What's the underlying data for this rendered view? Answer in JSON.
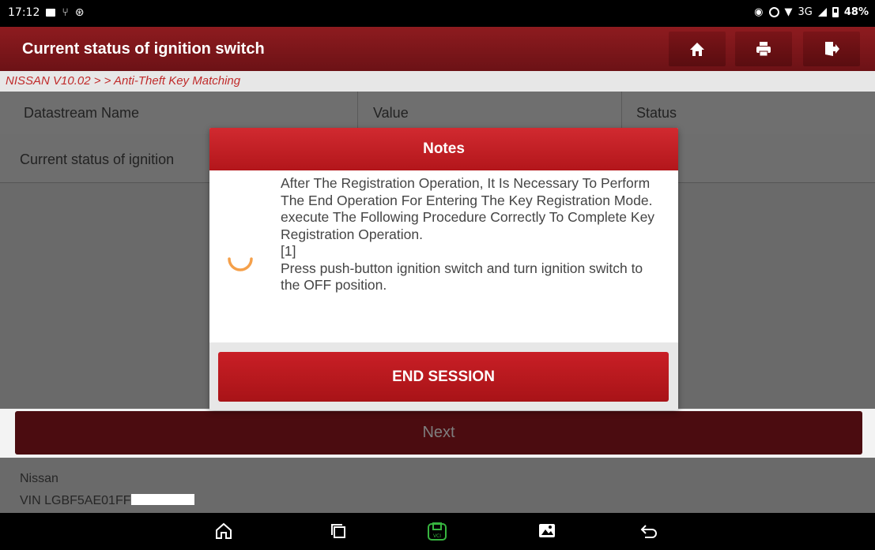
{
  "status_bar": {
    "time": "17:12",
    "network": "3G",
    "battery": "48%",
    "icons": [
      "image-icon",
      "usb-icon",
      "bluetooth-icon",
      "location-icon",
      "dnd-icon",
      "wifi-icon",
      "signal-icon",
      "battery-icon"
    ]
  },
  "header": {
    "title": "Current status of ignition switch",
    "buttons": [
      "home-icon",
      "print-icon",
      "exit-icon"
    ]
  },
  "breadcrumb": "NISSAN V10.02 > > Anti-Theft Key Matching",
  "table": {
    "columns": [
      "Datastream Name",
      "Value",
      "Status"
    ],
    "rows": [
      {
        "name": "Current status of ignition",
        "value": "",
        "status": ""
      }
    ]
  },
  "next_button": "Next",
  "footer": {
    "brand": "Nissan",
    "vin": "VIN LGBF5AE01FF"
  },
  "dialog": {
    "title": "Notes",
    "lines": [
      "After The Registration Operation, It Is Necessary To Perform The End Operation For Entering The Key Registration Mode.",
      "execute The Following Procedure Correctly To Complete Key Registration Operation.",
      "[1]",
      "Press push-button ignition switch and turn ignition switch to the OFF position."
    ],
    "button": "END SESSION"
  },
  "colors": {
    "header_red": "#7d161a",
    "dialog_red": "#c41f25",
    "spinner_orange": "#f5a04a",
    "breadcrumb_text": "#c02b2b"
  },
  "nav_bar": {
    "icons": [
      "home-nav-icon",
      "recents-icon",
      "vci-icon",
      "gallery-icon",
      "back-icon"
    ]
  }
}
